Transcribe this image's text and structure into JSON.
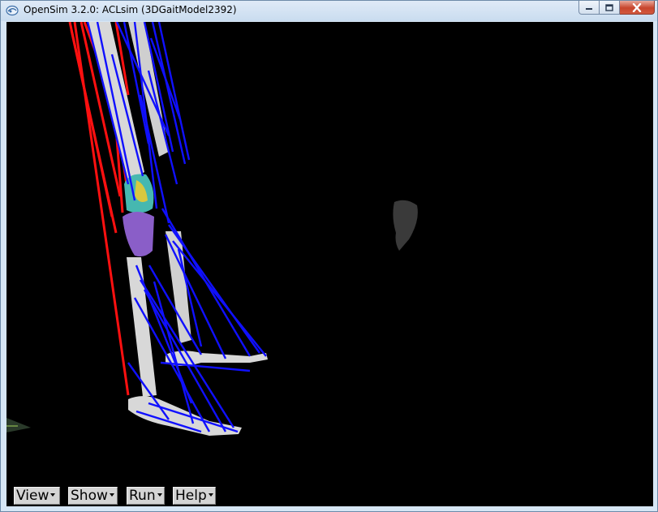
{
  "window": {
    "title": "OpenSim 3.2.0: ACLsim (3DGaitModel2392)",
    "app_icon": "opensim-logo-icon",
    "controls": {
      "minimize_icon": "minimize-icon",
      "maximize_icon": "maximize-icon",
      "close_icon": "close-icon"
    }
  },
  "viewport": {
    "background": "#000000",
    "muscle_colors": {
      "inactive": "#1010ff",
      "active": "#ff1010"
    },
    "bone_color": "#d8d8d8"
  },
  "menu_buttons": [
    {
      "label": "View"
    },
    {
      "label": "Show"
    },
    {
      "label": "Run"
    },
    {
      "label": "Help"
    }
  ]
}
